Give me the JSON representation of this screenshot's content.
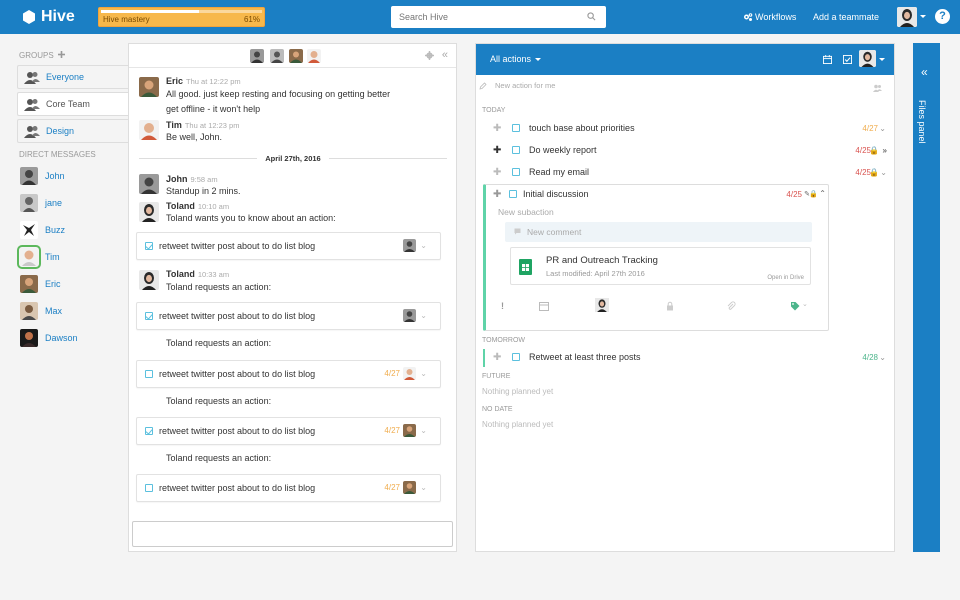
{
  "topbar": {
    "logo": "Hive",
    "mastery_label": "Hive mastery",
    "mastery_percent": "61%",
    "mastery_value": 0.61,
    "search_placeholder": "Search Hive",
    "workflows_label": "Workflows",
    "add_teammate_label": "Add a teammate",
    "help_label": "?"
  },
  "sidebar": {
    "groups_heading": "GROUPS",
    "groups": [
      {
        "label": "Everyone"
      },
      {
        "label": "Core Team"
      },
      {
        "label": "Design"
      }
    ],
    "dm_heading": "DIRECT MESSAGES",
    "direct_messages": [
      {
        "label": "John"
      },
      {
        "label": "jane"
      },
      {
        "label": "Buzz"
      },
      {
        "label": "Tim"
      },
      {
        "label": "Eric"
      },
      {
        "label": "Max"
      },
      {
        "label": "Dawson"
      }
    ]
  },
  "chat": {
    "messages": [
      {
        "name": "Eric",
        "time": "Thu at 12:22 pm",
        "lines": [
          "All good. just keep resting and focusing on getting better",
          "get offline - it won't help"
        ]
      },
      {
        "name": "Tim",
        "time": "Thu at 12:23 pm",
        "lines": [
          "Be well, John."
        ]
      },
      {
        "name": "John",
        "time": "9:58 am",
        "lines": [
          "Standup in 2 mins."
        ]
      },
      {
        "name": "Toland",
        "time": "10:10 am",
        "lines": [
          "Toland wants you to know about an action:"
        ]
      },
      {
        "name": "Toland",
        "time": "10:33 am",
        "lines": [
          "Toland requests an action:"
        ]
      }
    ],
    "date_separator": "April 27th, 2016",
    "requests_text": "Toland requests an action:",
    "cards": [
      {
        "text": "retweet twitter post about to do list blog",
        "date": "",
        "checked": true
      },
      {
        "text": "retweet twitter post about to do list blog",
        "date": "",
        "checked": true
      },
      {
        "text": "retweet twitter post about to do list blog",
        "date": "4/27",
        "checked": false
      },
      {
        "text": "retweet twitter post about to do list blog",
        "date": "4/27",
        "checked": true
      },
      {
        "text": "retweet twitter post about to do list blog",
        "date": "4/27",
        "checked": false
      }
    ]
  },
  "actions": {
    "title": "All actions",
    "new_action_placeholder": "New action for me",
    "today_heading": "TODAY",
    "today": [
      {
        "text": "touch base about priorities",
        "date": "4/27",
        "date_color": "#f0ad4e"
      },
      {
        "text": "Do weekly report",
        "date": "4/25",
        "date_color": "#d9534f"
      },
      {
        "text": "Read my email",
        "date": "4/25",
        "date_color": "#d9534f"
      },
      {
        "text": "Initial discussion",
        "date": "4/25",
        "date_color": "#d9534f"
      }
    ],
    "expanded": {
      "new_subaction": "New subaction",
      "new_comment": "New comment",
      "doc_title": "PR and Outreach Tracking",
      "doc_modified": "Last modified: April 27th 2016",
      "doc_open": "Open in Drive",
      "urgent_mark": "!"
    },
    "tomorrow_heading": "TOMORROW",
    "tomorrow": [
      {
        "text": "Retweet at least three posts",
        "date": "4/28",
        "date_color": "#4cb58b"
      }
    ],
    "future_heading": "FUTURE",
    "future_empty": "Nothing planned yet",
    "nodate_heading": "NO DATE",
    "nodate_empty": "Nothing planned yet"
  },
  "files_panel": {
    "label": "Files panel"
  },
  "colors": {
    "brand_blue": "#1b7fc4",
    "mastery_orange": "#f7b84b",
    "overdue_red": "#d9534f",
    "soon_orange": "#f0ad4e",
    "ok_green": "#4cb58b"
  }
}
